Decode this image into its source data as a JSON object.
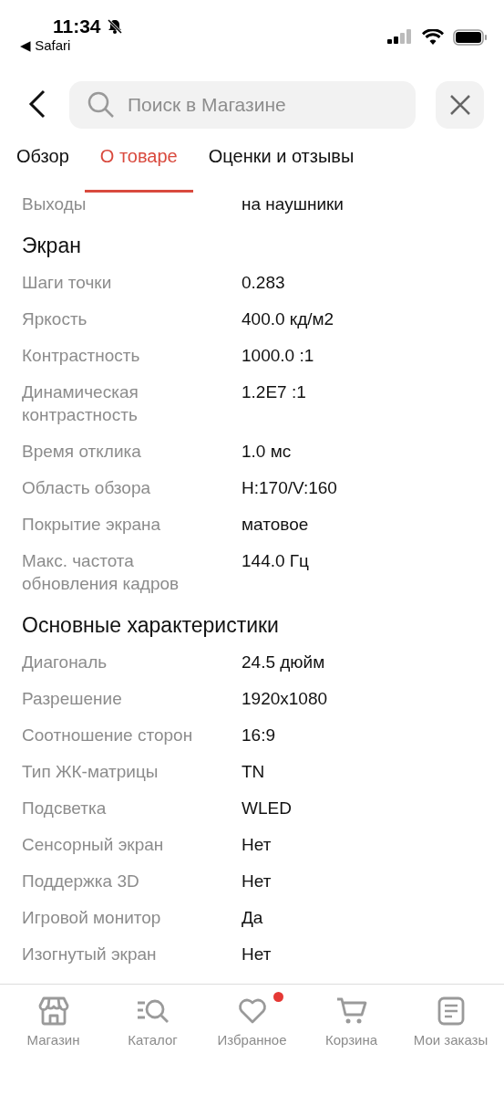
{
  "status_bar": {
    "time": "11:34",
    "back_app": "◀ Safari"
  },
  "search": {
    "placeholder": "Поиск в Магазине"
  },
  "tabs": [
    {
      "label": "Обзор",
      "selected": false
    },
    {
      "label": "О товаре",
      "selected": true
    },
    {
      "label": "Оценки и отзывы",
      "selected": false
    }
  ],
  "spec_sections": [
    {
      "rows": [
        {
          "label": "Выходы",
          "value": "на наушники"
        }
      ]
    },
    {
      "title": "Экран",
      "rows": [
        {
          "label": "Шаги точки",
          "value": "0.283"
        },
        {
          "label": "Яркость",
          "value": "400.0 кд/м2"
        },
        {
          "label": "Контрастность",
          "value": "1000.0 :1"
        },
        {
          "label": "Динамическая контрастность",
          "value": "1.2E7 :1"
        },
        {
          "label": "Время отклика",
          "value": "1.0 мс"
        },
        {
          "label": "Область обзора",
          "value": "H:170/V:160"
        },
        {
          "label": "Покрытие экрана",
          "value": "матовое"
        },
        {
          "label": "Макс. частота обновления кадров",
          "value": "144.0 Гц"
        }
      ]
    },
    {
      "title": "Основные характеристики",
      "rows": [
        {
          "label": "Диагональ",
          "value": "24.5 дюйм"
        },
        {
          "label": "Разрешение",
          "value": "1920x1080"
        },
        {
          "label": "Соотношение сторон",
          "value": "16:9"
        },
        {
          "label": "Тип ЖК-матрицы",
          "value": "TN"
        },
        {
          "label": "Подсветка",
          "value": "WLED"
        },
        {
          "label": "Сенсорный экран",
          "value": "Нет"
        },
        {
          "label": "Поддержка 3D",
          "value": "Нет"
        },
        {
          "label": "Игровой монитор",
          "value": "Да"
        },
        {
          "label": "Изогнутый экран",
          "value": "Нет"
        }
      ]
    }
  ],
  "bottom_nav": [
    {
      "kind": "store",
      "label": "Магазин",
      "badge": false
    },
    {
      "kind": "catalog",
      "label": "Каталог",
      "badge": false
    },
    {
      "kind": "favorites",
      "label": "Избранное",
      "badge": true
    },
    {
      "kind": "cart",
      "label": "Корзина",
      "badge": false
    },
    {
      "kind": "orders",
      "label": "Мои заказы",
      "badge": false
    }
  ]
}
